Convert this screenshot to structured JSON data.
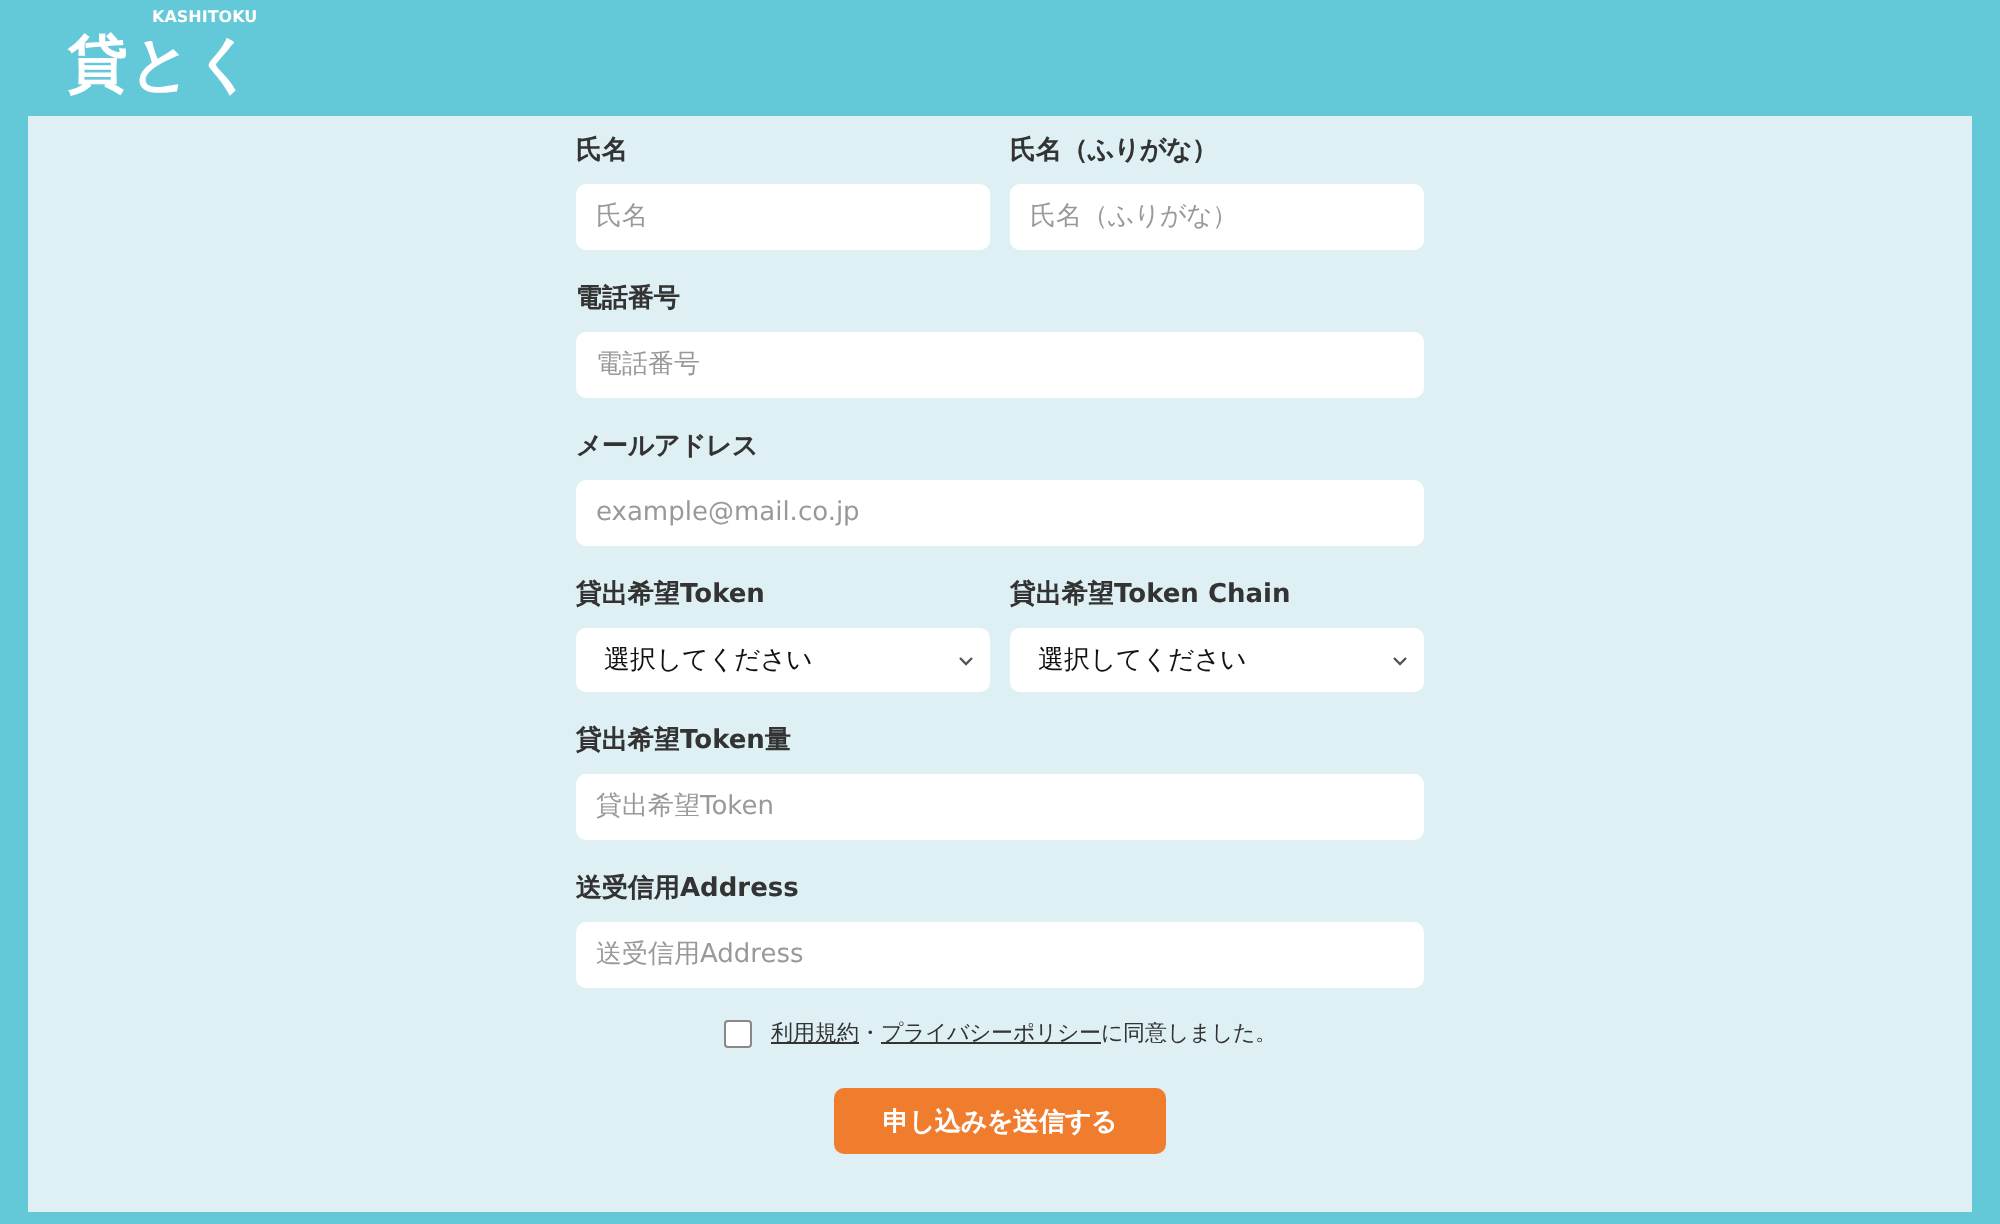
{
  "logo": {
    "mark": "貸とく",
    "subtitle": "KASHITOKU"
  },
  "rows": [
    {
      "fields": [
        {
          "kind": "input",
          "label": "氏名",
          "placeholder": "氏名"
        },
        {
          "kind": "input",
          "label": "氏名（ふりがな）",
          "placeholder": "氏名（ふりがな）"
        }
      ]
    },
    {
      "fields": [
        {
          "kind": "input",
          "label": "電話番号",
          "placeholder": "電話番号"
        }
      ]
    },
    {
      "fields": [
        {
          "kind": "input",
          "label": "メールアドレス",
          "placeholder": "example@mail.co.jp"
        }
      ]
    },
    {
      "fields": [
        {
          "kind": "select",
          "label": "貸出希望Token",
          "value": "選択してください"
        },
        {
          "kind": "select",
          "label": "貸出希望Token Chain",
          "value": "選択してください"
        }
      ]
    },
    {
      "fields": [
        {
          "kind": "input",
          "label": "貸出希望Token量",
          "placeholder": "貸出希望Token"
        }
      ]
    },
    {
      "fields": [
        {
          "kind": "input",
          "label": "送受信用Address",
          "placeholder": "送受信用Address"
        }
      ]
    }
  ],
  "agreement": {
    "checked": false,
    "terms_link": "利用規約",
    "separator": "・",
    "privacy_link": "プライバシーポリシー",
    "text": "に同意しました。"
  },
  "submit_button": "申し込みを送信する"
}
